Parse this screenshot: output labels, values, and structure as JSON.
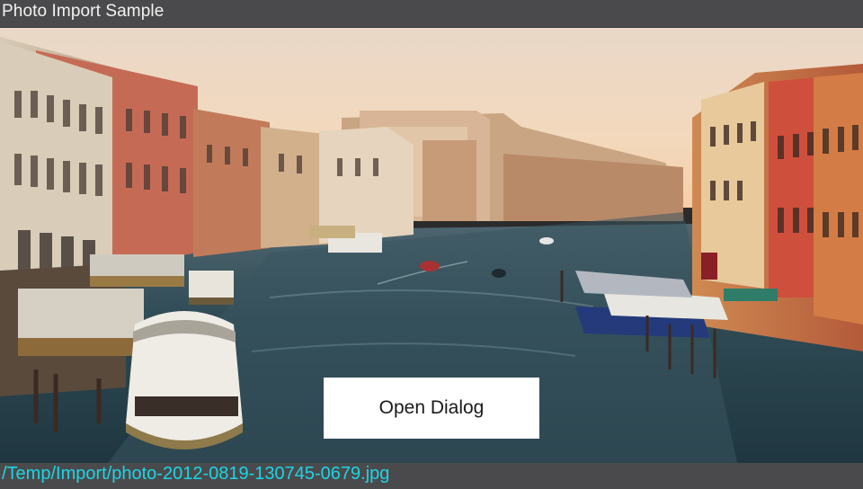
{
  "window": {
    "title": "Photo Import Sample"
  },
  "main": {
    "open_button_label": "Open Dialog"
  },
  "status": {
    "file_path": "/Temp/Import/photo-2012-0819-130745-0679.jpg"
  },
  "colors": {
    "bar_background": "#4a4a4c",
    "path_text": "#19d6e6",
    "button_background": "#ffffff"
  }
}
